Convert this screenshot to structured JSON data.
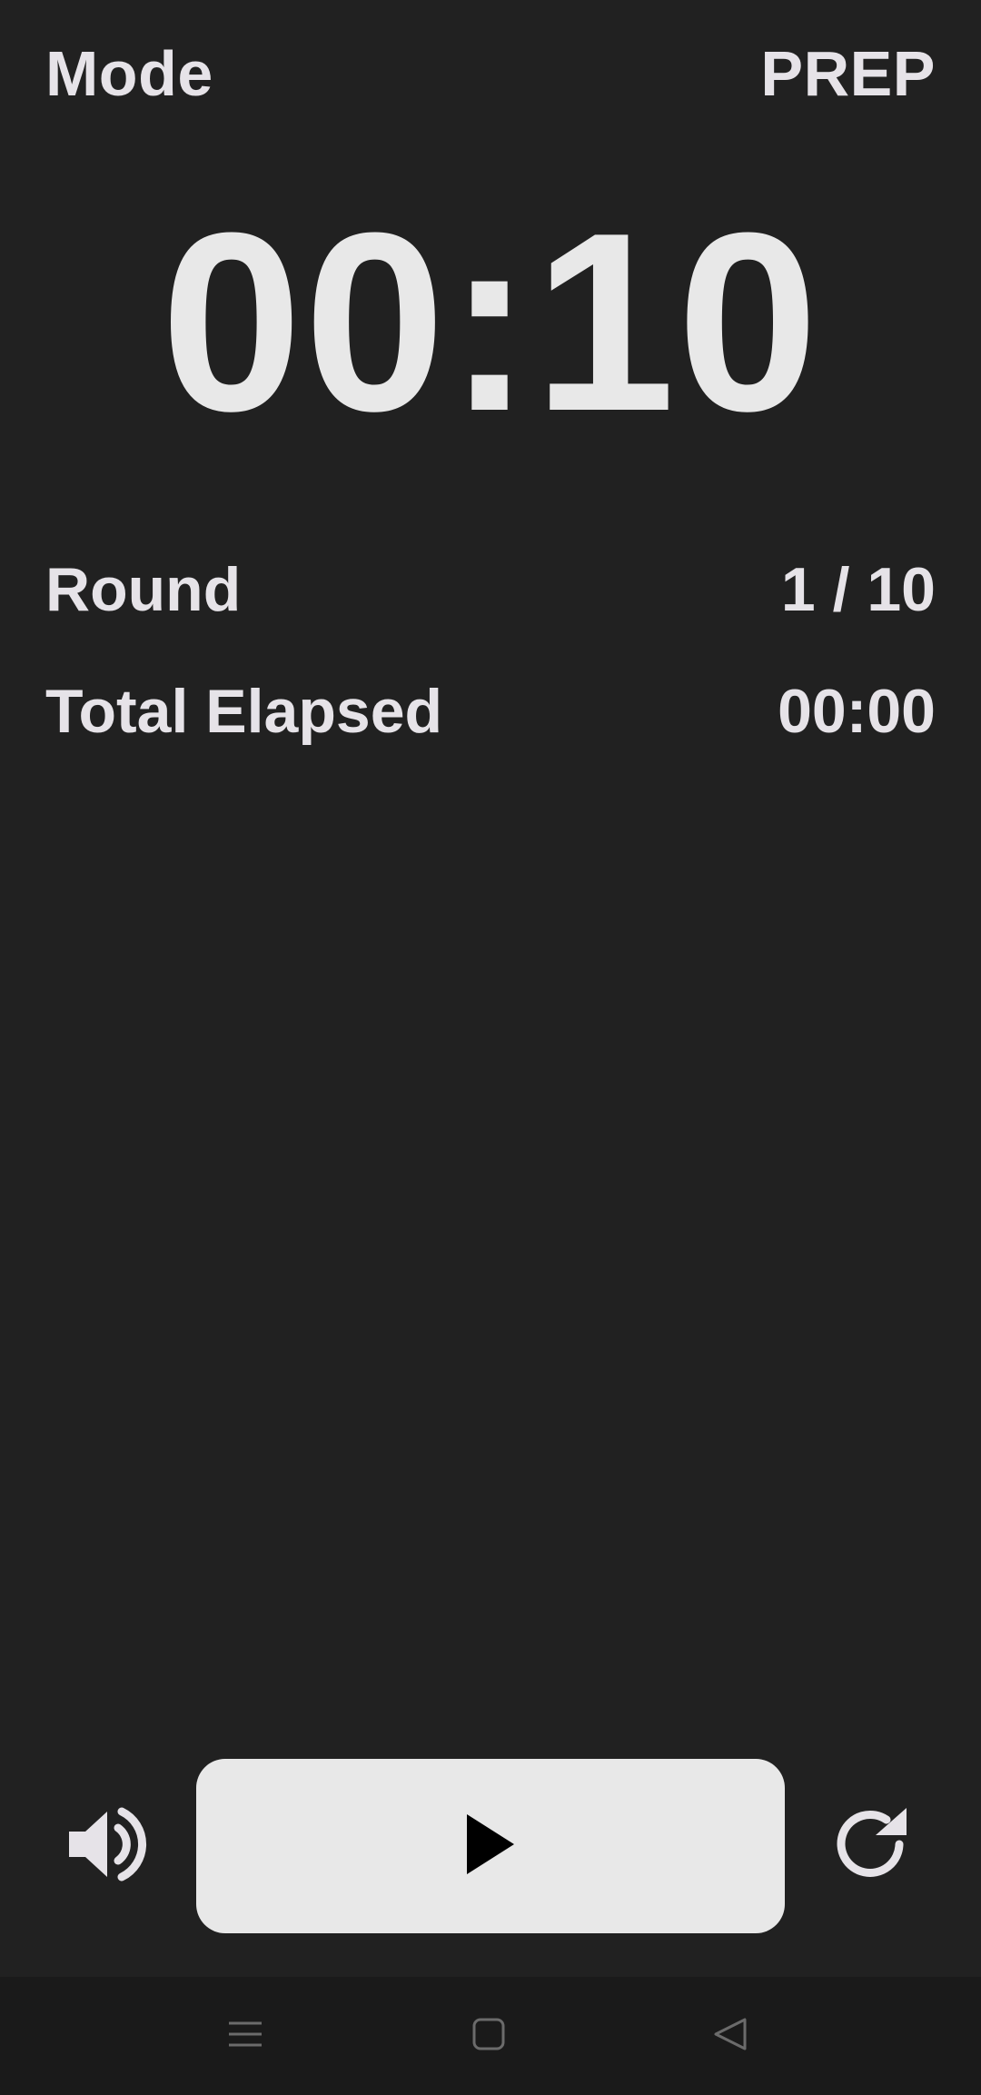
{
  "header": {
    "mode_label": "Mode",
    "mode_value": "PREP"
  },
  "timer": {
    "display": "00:10"
  },
  "stats": {
    "round_label": "Round",
    "round_value": "1 / 10",
    "elapsed_label": "Total Elapsed",
    "elapsed_value": "00:00"
  },
  "controls": {
    "volume_icon": "volume-icon",
    "play_icon": "play-icon",
    "reset_icon": "reset-icon"
  },
  "navbar": {
    "recents_icon": "menu-icon",
    "home_icon": "home-icon",
    "back_icon": "back-icon"
  },
  "colors": {
    "background": "#212121",
    "text": "#e6e3e8",
    "button": "#e8e8e8",
    "navbar": "#1a1a1a"
  }
}
